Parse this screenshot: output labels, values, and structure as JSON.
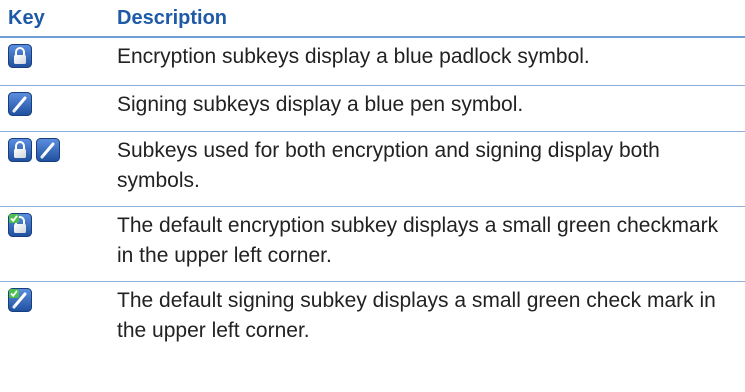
{
  "headers": {
    "key": "Key",
    "description": "Description"
  },
  "rows": [
    {
      "icons": [
        "blue-padlock-icon"
      ],
      "description": "Encryption subkeys display a blue padlock symbol."
    },
    {
      "icons": [
        "blue-pen-icon"
      ],
      "description": "Signing subkeys display a blue pen symbol."
    },
    {
      "icons": [
        "blue-padlock-icon",
        "blue-pen-icon"
      ],
      "description": "Subkeys used for both encryption and signing display both symbols."
    },
    {
      "icons": [
        "padlock-green-check-icon"
      ],
      "description": "The default encryption subkey displays a small green checkmark in the upper left corner."
    },
    {
      "icons": [
        "pen-green-check-icon"
      ],
      "description": "The default signing subkey displays a small green check mark in the upper left corner."
    }
  ],
  "colors": {
    "header_text": "#1f5aa6",
    "rule": "#8aaed8",
    "icon_blue": "#2a5fb4",
    "check_green": "#3aa63a"
  }
}
